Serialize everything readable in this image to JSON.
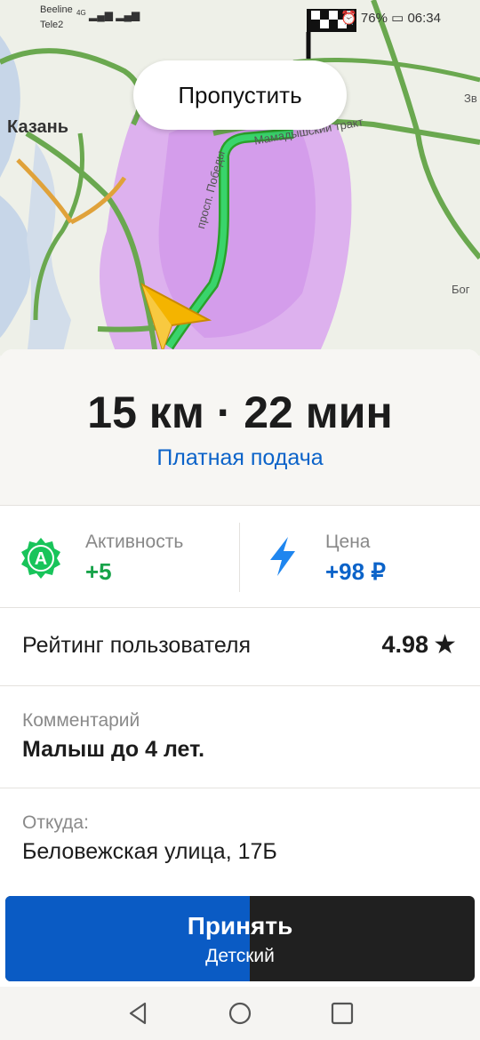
{
  "status_bar": {
    "carrier_1": "Beeline",
    "carrier_2": "Tele2",
    "signal_1": "4G",
    "battery": "76%",
    "time": "06:34"
  },
  "map": {
    "skip_label": "Пропустить",
    "city_label": "Казань",
    "street_tract": "Мамадышский тракт",
    "street_prospect": "просп. Победы",
    "place_right_1": "Зв",
    "place_right_2": "Бог"
  },
  "summary": {
    "distance_time": "15 км · 22 мин",
    "paid_pickup": "Платная подача"
  },
  "stats": {
    "activity": {
      "label": "Активность",
      "value": "+5",
      "badge_letter": "A"
    },
    "price": {
      "label": "Цена",
      "value": "+98 ₽"
    }
  },
  "rating": {
    "label": "Рейтинг пользователя",
    "value": "4.98",
    "star": "★"
  },
  "comment": {
    "label": "Комментарий",
    "value": "Малыш до 4 лет."
  },
  "from": {
    "label": "Откуда:",
    "value": "Беловежская улица, 17Б"
  },
  "accept_button": {
    "title": "Принять",
    "subtitle": "Детский",
    "progress": 0.52,
    "color_fill": "#0a5bc4",
    "color_rest": "#202020"
  },
  "colors": {
    "accent_blue": "#0b63c9",
    "accent_green": "#18a34a"
  }
}
